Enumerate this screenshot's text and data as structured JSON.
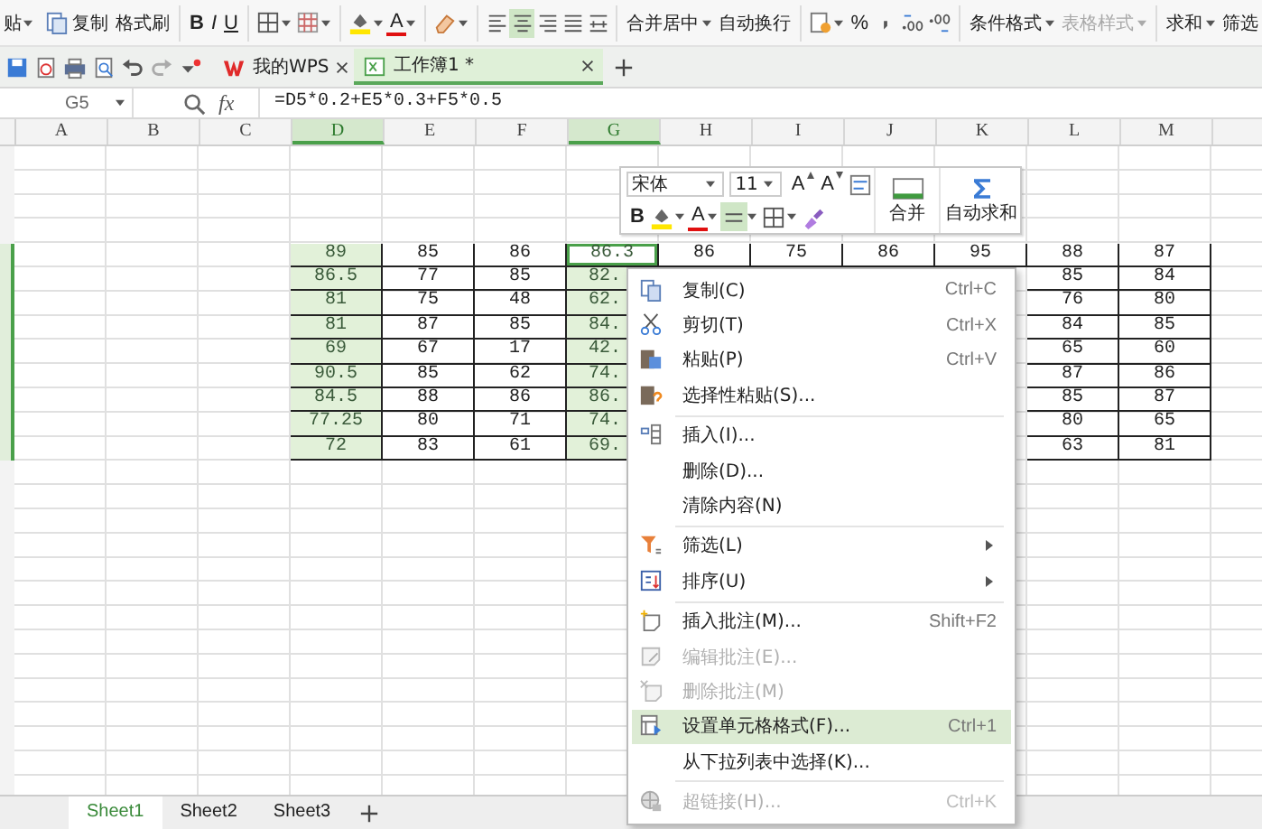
{
  "ribbon": {
    "paste": "贴",
    "copy": "复制",
    "format_painter": "格式刷",
    "bold": "B",
    "italic": "I",
    "underline": "U",
    "font_color": "A",
    "alignment": [
      {
        "selected": false
      },
      {
        "selected": true
      },
      {
        "selected": false
      },
      {
        "selected": false
      },
      {
        "selected": false
      }
    ],
    "merge_center": "合并居中",
    "wrap_text": "自动换行",
    "percent": "%",
    "conditional_format": {
      "label": "条件格式",
      "disabled": false
    },
    "table_style": {
      "label": "表格样式",
      "disabled": true
    },
    "sum": "求和",
    "filter": "筛选"
  },
  "tabs": [
    {
      "label": "我的WPS",
      "selected": false
    },
    {
      "label": "工作簿1 *",
      "selected": true
    }
  ],
  "formula_bar": {
    "name_box": "G5",
    "fx": "fx",
    "formula": "=D5*0.2+E5*0.3+F5*0.5"
  },
  "sheet": {
    "columns": [
      {
        "label": "A",
        "selected": false
      },
      {
        "label": "B",
        "selected": false
      },
      {
        "label": "C",
        "selected": false
      },
      {
        "label": "D",
        "selected": true
      },
      {
        "label": "E",
        "selected": false
      },
      {
        "label": "F",
        "selected": false
      },
      {
        "label": "G",
        "selected": true
      },
      {
        "label": "H",
        "selected": false
      },
      {
        "label": "I",
        "selected": false
      },
      {
        "label": "J",
        "selected": false
      },
      {
        "label": "K",
        "selected": false
      },
      {
        "label": "L",
        "selected": false
      },
      {
        "label": "M",
        "selected": false
      }
    ],
    "rows": [
      {
        "selected": true,
        "cells": [
          "",
          "",
          "",
          {
            "text": "89",
            "selected": true,
            "active": false
          },
          {
            "text": "85",
            "selected": false,
            "active": false
          },
          {
            "text": "86",
            "selected": false,
            "active": false
          },
          {
            "text": "86.3",
            "selected": true,
            "active": true
          },
          {
            "text": "86",
            "selected": false,
            "active": false
          },
          {
            "text": "75",
            "selected": false,
            "active": false
          },
          {
            "text": "86",
            "selected": false,
            "active": false
          },
          {
            "text": "95",
            "selected": false,
            "active": false
          },
          {
            "text": "88",
            "selected": false,
            "active": false
          },
          {
            "text": "87",
            "selected": false,
            "active": false
          }
        ]
      },
      {
        "selected": true,
        "cells": [
          "",
          "",
          "",
          {
            "text": "86.5",
            "selected": true,
            "active": false
          },
          {
            "text": "77",
            "selected": false,
            "active": false
          },
          {
            "text": "85",
            "selected": false,
            "active": false
          },
          {
            "text": "82.",
            "selected": true,
            "active": false
          },
          null,
          null,
          null,
          null,
          {
            "text": "85",
            "selected": false,
            "active": false
          },
          {
            "text": "84",
            "selected": false,
            "active": false
          }
        ]
      },
      {
        "selected": true,
        "cells": [
          "",
          "",
          "",
          {
            "text": "81",
            "selected": true,
            "active": false
          },
          {
            "text": "75",
            "selected": false,
            "active": false
          },
          {
            "text": "48",
            "selected": false,
            "active": false
          },
          {
            "text": "62.",
            "selected": true,
            "active": false
          },
          null,
          null,
          null,
          null,
          {
            "text": "76",
            "selected": false,
            "active": false
          },
          {
            "text": "80",
            "selected": false,
            "active": false
          }
        ]
      },
      {
        "selected": true,
        "cells": [
          "",
          "",
          "",
          {
            "text": "81",
            "selected": true,
            "active": false
          },
          {
            "text": "87",
            "selected": false,
            "active": false
          },
          {
            "text": "85",
            "selected": false,
            "active": false
          },
          {
            "text": "84.",
            "selected": true,
            "active": false
          },
          null,
          null,
          null,
          null,
          {
            "text": "84",
            "selected": false,
            "active": false
          },
          {
            "text": "85",
            "selected": false,
            "active": false
          }
        ]
      },
      {
        "selected": true,
        "cells": [
          "",
          "",
          "",
          {
            "text": "69",
            "selected": true,
            "active": false
          },
          {
            "text": "67",
            "selected": false,
            "active": false
          },
          {
            "text": "17",
            "selected": false,
            "active": false
          },
          {
            "text": "42.",
            "selected": true,
            "active": false
          },
          null,
          null,
          null,
          null,
          {
            "text": "65",
            "selected": false,
            "active": false
          },
          {
            "text": "60",
            "selected": false,
            "active": false
          }
        ]
      },
      {
        "selected": true,
        "cells": [
          "",
          "",
          "",
          {
            "text": "90.5",
            "selected": true,
            "active": false
          },
          {
            "text": "85",
            "selected": false,
            "active": false
          },
          {
            "text": "62",
            "selected": false,
            "active": false
          },
          {
            "text": "74.",
            "selected": true,
            "active": false
          },
          null,
          null,
          null,
          null,
          {
            "text": "87",
            "selected": false,
            "active": false
          },
          {
            "text": "86",
            "selected": false,
            "active": false
          }
        ]
      },
      {
        "selected": true,
        "cells": [
          "",
          "",
          "",
          {
            "text": "84.5",
            "selected": true,
            "active": false
          },
          {
            "text": "88",
            "selected": false,
            "active": false
          },
          {
            "text": "86",
            "selected": false,
            "active": false
          },
          {
            "text": "86.",
            "selected": true,
            "active": false
          },
          null,
          null,
          null,
          null,
          {
            "text": "85",
            "selected": false,
            "active": false
          },
          {
            "text": "87",
            "selected": false,
            "active": false
          }
        ]
      },
      {
        "selected": true,
        "cells": [
          "",
          "",
          "",
          {
            "text": "77.25",
            "selected": true,
            "active": false
          },
          {
            "text": "80",
            "selected": false,
            "active": false
          },
          {
            "text": "71",
            "selected": false,
            "active": false
          },
          {
            "text": "74.",
            "selected": true,
            "active": false
          },
          null,
          null,
          null,
          null,
          {
            "text": "80",
            "selected": false,
            "active": false
          },
          {
            "text": "65",
            "selected": false,
            "active": false
          }
        ]
      },
      {
        "selected": true,
        "cells": [
          "",
          "",
          "",
          {
            "text": "72",
            "selected": true,
            "active": false
          },
          {
            "text": "83",
            "selected": false,
            "active": false
          },
          {
            "text": "61",
            "selected": false,
            "active": false
          },
          {
            "text": "69.",
            "selected": true,
            "active": false
          },
          null,
          null,
          null,
          null,
          {
            "text": "63",
            "selected": false,
            "active": false
          },
          {
            "text": "81",
            "selected": false,
            "active": false
          }
        ]
      }
    ]
  },
  "mini_toolbar": {
    "font": "宋体",
    "size": "11",
    "grow_font": "A",
    "shrink_font": "A",
    "bold": "B",
    "font_color": "A",
    "merge": "合并",
    "autosum": "自动求和"
  },
  "context_menu": [
    {
      "kind": "item",
      "label": "复制(C)",
      "shortcut": "Ctrl+C",
      "submenu": false,
      "disabled": false,
      "selected": false
    },
    {
      "kind": "item",
      "label": "剪切(T)",
      "shortcut": "Ctrl+X",
      "submenu": false,
      "disabled": false,
      "selected": false
    },
    {
      "kind": "item",
      "label": "粘贴(P)",
      "shortcut": "Ctrl+V",
      "submenu": false,
      "disabled": false,
      "selected": false
    },
    {
      "kind": "item",
      "label": "选择性粘贴(S)...",
      "submenu": false,
      "disabled": false,
      "selected": false
    },
    {
      "kind": "separator"
    },
    {
      "kind": "item",
      "label": "插入(I)...",
      "submenu": false,
      "disabled": false,
      "selected": false
    },
    {
      "kind": "item",
      "label": "删除(D)...",
      "submenu": false,
      "disabled": false,
      "selected": false
    },
    {
      "kind": "item",
      "label": "清除内容(N)",
      "submenu": false,
      "disabled": false,
      "selected": false
    },
    {
      "kind": "separator"
    },
    {
      "kind": "item",
      "label": "筛选(L)",
      "submenu": true,
      "disabled": false,
      "selected": false
    },
    {
      "kind": "item",
      "label": "排序(U)",
      "submenu": true,
      "disabled": false,
      "selected": false
    },
    {
      "kind": "separator"
    },
    {
      "kind": "item",
      "label": "插入批注(M)...",
      "shortcut": "Shift+F2",
      "submenu": false,
      "disabled": false,
      "selected": false
    },
    {
      "kind": "item",
      "label": "编辑批注(E)...",
      "submenu": false,
      "disabled": true,
      "selected": false
    },
    {
      "kind": "item",
      "label": "删除批注(M)",
      "submenu": false,
      "disabled": true,
      "selected": false
    },
    {
      "kind": "item",
      "label": "设置单元格格式(F)...",
      "shortcut": "Ctrl+1",
      "submenu": false,
      "disabled": false,
      "selected": true
    },
    {
      "kind": "item",
      "label": "从下拉列表中选择(K)...",
      "submenu": false,
      "disabled": false,
      "selected": false
    },
    {
      "kind": "separator"
    },
    {
      "kind": "item",
      "label": "超链接(H)...",
      "shortcut": "Ctrl+K",
      "submenu": false,
      "disabled": true,
      "selected": false
    }
  ],
  "sheet_tabs": [
    {
      "label": "Sheet1",
      "selected": true
    },
    {
      "label": "Sheet2",
      "selected": false
    },
    {
      "label": "Sheet3",
      "selected": false
    }
  ]
}
